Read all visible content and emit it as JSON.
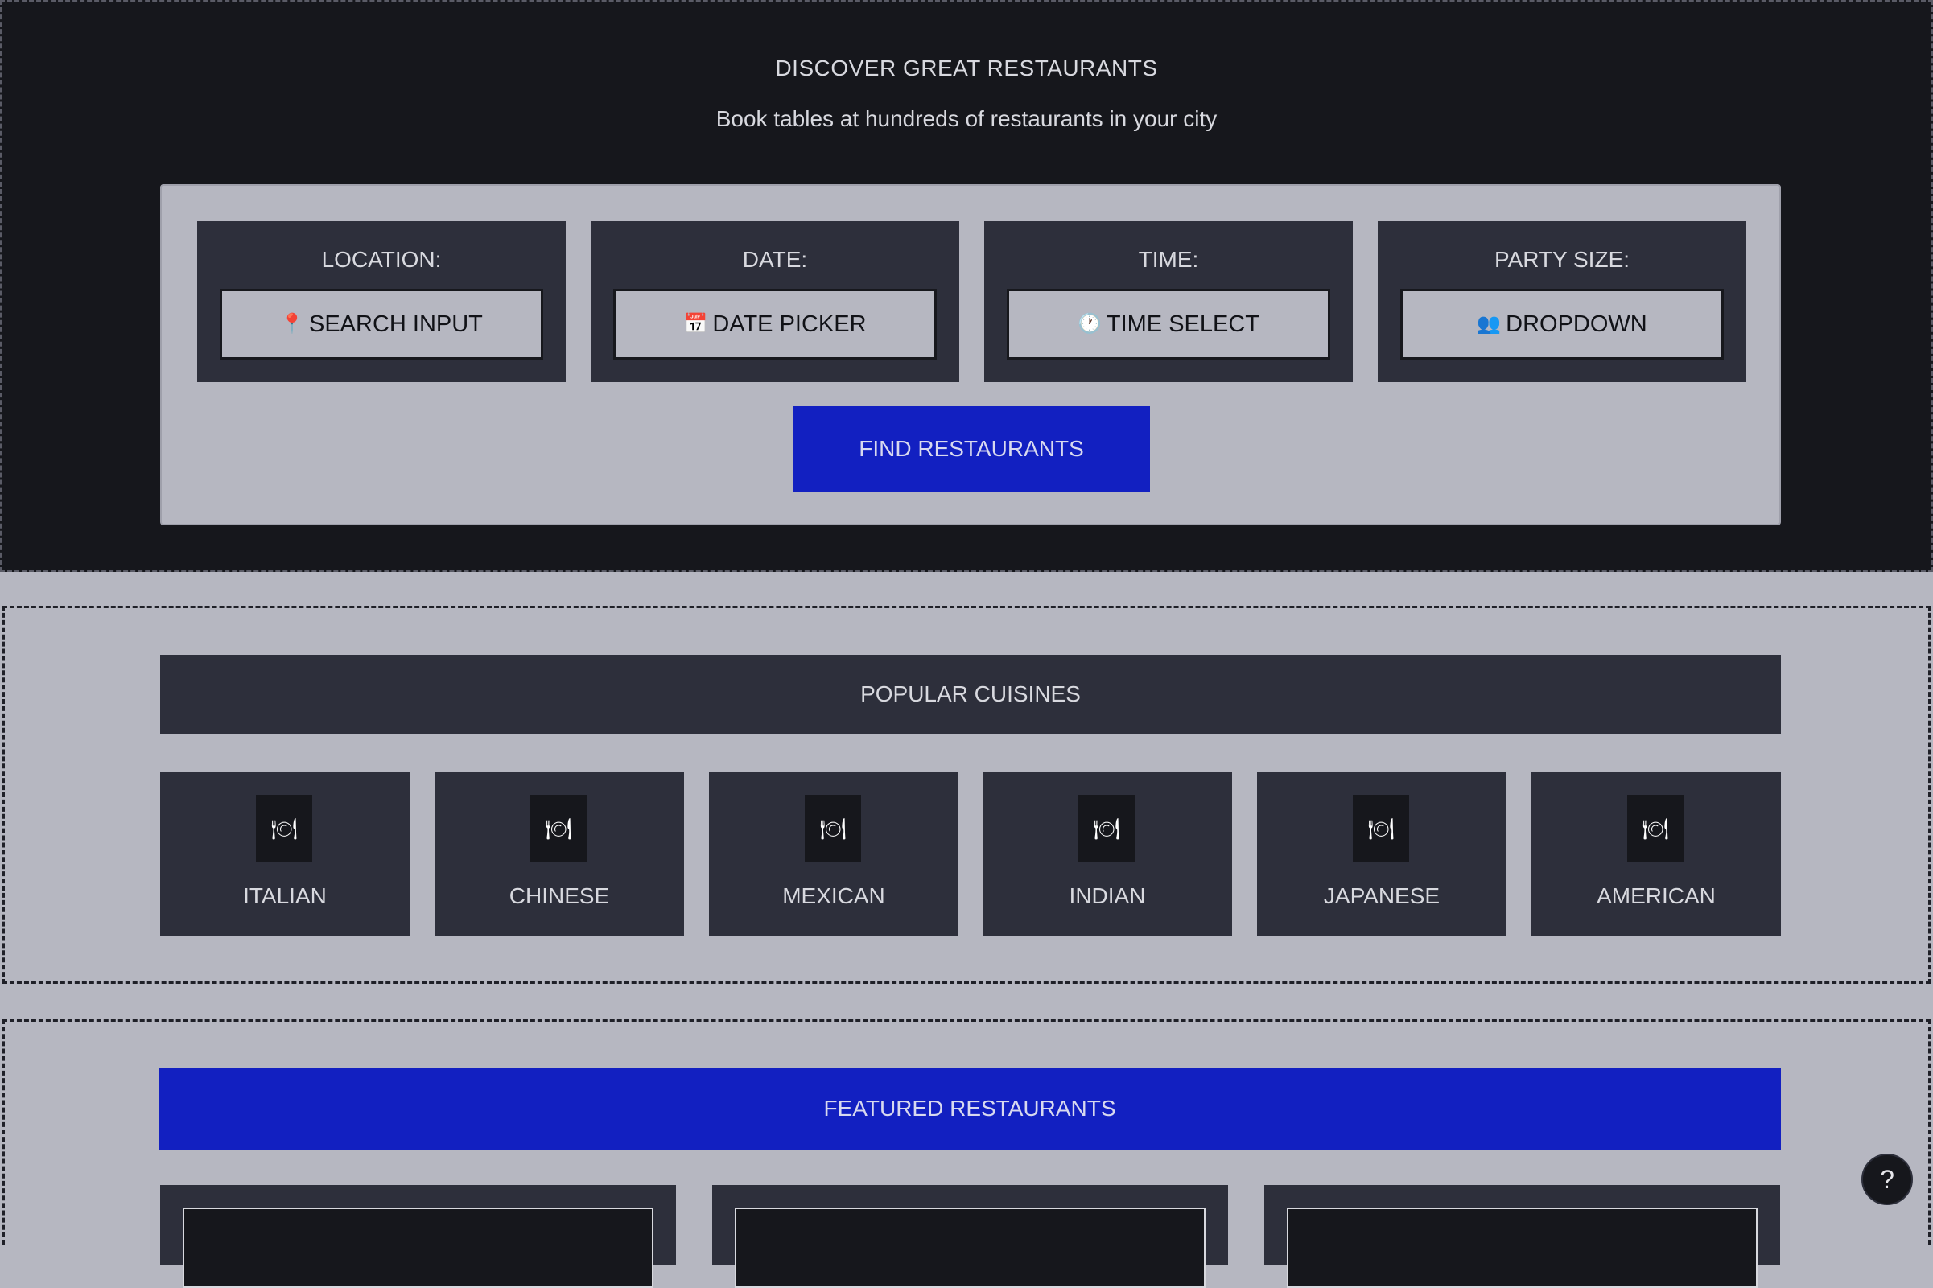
{
  "hero": {
    "title": "DISCOVER GREAT RESTAURANTS",
    "subtitle": "Book tables at hundreds of restaurants in your city"
  },
  "search": {
    "fields": [
      {
        "label": "LOCATION:",
        "icon": "📍",
        "icon_name": "pin-icon",
        "value": "SEARCH INPUT"
      },
      {
        "label": "DATE:",
        "icon": "📅",
        "icon_name": "calendar-icon",
        "value": "DATE PICKER"
      },
      {
        "label": "TIME:",
        "icon": "🕐",
        "icon_name": "clock-icon",
        "value": "TIME SELECT"
      },
      {
        "label": "PARTY SIZE:",
        "icon": "👥",
        "icon_name": "people-icon",
        "value": "DROPDOWN"
      }
    ],
    "find_label": "FIND RESTAURANTS"
  },
  "cuisines": {
    "heading": "POPULAR CUISINES",
    "icon": "🍽",
    "items": [
      "ITALIAN",
      "CHINESE",
      "MEXICAN",
      "INDIAN",
      "JAPANESE",
      "AMERICAN"
    ]
  },
  "featured": {
    "heading": "FEATURED RESTAURANTS"
  },
  "help": {
    "label": "?"
  },
  "colors": {
    "dark_bg": "#16171c",
    "card_bg": "#2d2f3b",
    "page_bg": "#b6b7c1",
    "accent_blue": "#1220c1"
  }
}
